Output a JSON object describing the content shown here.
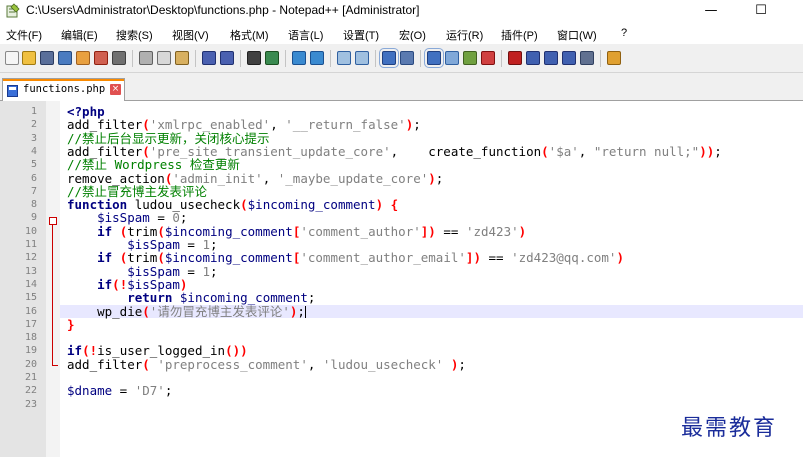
{
  "window": {
    "title": "C:\\Users\\Administrator\\Desktop\\functions.php - Notepad++ [Administrator]",
    "minimize": "—",
    "maximize": "☐"
  },
  "menu": [
    "文件(F)",
    "编辑(E)",
    "搜索(S)",
    "视图(V)",
    "格式(M)",
    "语言(L)",
    "设置(T)",
    "宏(O)",
    "运行(R)",
    "插件(P)",
    "窗口(W)",
    "?"
  ],
  "tab": {
    "label": "functions.php",
    "close": "×"
  },
  "editor": {
    "current_line": 16,
    "line_numbers": [
      "1",
      "2",
      "3",
      "4",
      "5",
      "6",
      "7",
      "8",
      "9",
      "10",
      "11",
      "12",
      "13",
      "14",
      "15",
      "16",
      "17",
      "18",
      "19",
      "20",
      "21",
      "22",
      "23"
    ],
    "lines": [
      [
        [
          "kw",
          "<?php"
        ]
      ],
      [
        [
          "",
          "add_filter"
        ],
        [
          "op",
          "("
        ],
        [
          "str",
          "'xmlrpc_enabled'"
        ],
        [
          "",
          ", "
        ],
        [
          "str",
          "'__return_false'"
        ],
        [
          "op",
          ")"
        ],
        [
          "",
          ";"
        ]
      ],
      [
        [
          "cmt",
          "//禁止后台显示更新，关闭核心提示"
        ]
      ],
      [
        [
          "",
          "add_filter"
        ],
        [
          "op",
          "("
        ],
        [
          "str",
          "'pre_site_transient_update_core'"
        ],
        [
          "",
          ",    create_function"
        ],
        [
          "op",
          "("
        ],
        [
          "str",
          "'$a'"
        ],
        [
          "",
          ", "
        ],
        [
          "str",
          "\"return null;\""
        ],
        [
          "op",
          "))"
        ],
        [
          "",
          ";"
        ]
      ],
      [
        [
          "cmt",
          "//禁止 Wordpress 检查更新"
        ]
      ],
      [
        [
          "",
          "remove_action"
        ],
        [
          "op",
          "("
        ],
        [
          "str",
          "'admin_init'"
        ],
        [
          "",
          ", "
        ],
        [
          "str",
          "'_maybe_update_core'"
        ],
        [
          "op",
          ")"
        ],
        [
          "",
          ";"
        ]
      ],
      [
        [
          "cmt",
          "//禁止冒充博主发表评论"
        ]
      ],
      [
        [
          "kw",
          "function"
        ],
        [
          "",
          " ludou_usecheck"
        ],
        [
          "op",
          "("
        ],
        [
          "var",
          "$incoming_comment"
        ],
        [
          "op",
          ")"
        ],
        [
          "",
          " "
        ],
        [
          "op",
          "{"
        ]
      ],
      [
        [
          "",
          "    "
        ],
        [
          "var",
          "$isSpam"
        ],
        [
          "",
          " = "
        ],
        [
          "str",
          "0"
        ],
        [
          "",
          ";"
        ]
      ],
      [
        [
          "",
          "    "
        ],
        [
          "kw",
          "if"
        ],
        [
          "",
          " "
        ],
        [
          "op",
          "("
        ],
        [
          "",
          "trim"
        ],
        [
          "op",
          "("
        ],
        [
          "var",
          "$incoming_comment"
        ],
        [
          "op",
          "["
        ],
        [
          "str",
          "'comment_author'"
        ],
        [
          "op",
          "])"
        ],
        [
          "",
          " == "
        ],
        [
          "str",
          "'zd423'"
        ],
        [
          "op",
          ")"
        ]
      ],
      [
        [
          "",
          "        "
        ],
        [
          "var",
          "$isSpam"
        ],
        [
          "",
          " = "
        ],
        [
          "str",
          "1"
        ],
        [
          "",
          ";"
        ]
      ],
      [
        [
          "",
          "    "
        ],
        [
          "kw",
          "if"
        ],
        [
          "",
          " "
        ],
        [
          "op",
          "("
        ],
        [
          "",
          "trim"
        ],
        [
          "op",
          "("
        ],
        [
          "var",
          "$incoming_comment"
        ],
        [
          "op",
          "["
        ],
        [
          "str",
          "'comment_author_email'"
        ],
        [
          "op",
          "])"
        ],
        [
          "",
          " == "
        ],
        [
          "str",
          "'zd423@qq.com'"
        ],
        [
          "op",
          ")"
        ]
      ],
      [
        [
          "",
          "        "
        ],
        [
          "var",
          "$isSpam"
        ],
        [
          "",
          " = "
        ],
        [
          "str",
          "1"
        ],
        [
          "",
          ";"
        ]
      ],
      [
        [
          "",
          "    "
        ],
        [
          "kw",
          "if"
        ],
        [
          "op",
          "(!"
        ],
        [
          "var",
          "$isSpam"
        ],
        [
          "op",
          ")"
        ]
      ],
      [
        [
          "",
          "        "
        ],
        [
          "kw",
          "return"
        ],
        [
          "",
          " "
        ],
        [
          "var",
          "$incoming_comment"
        ],
        [
          "",
          ";"
        ]
      ],
      [
        [
          "",
          "    wp_die"
        ],
        [
          "op",
          "("
        ],
        [
          "str",
          "'请勿冒充博主发表评论'"
        ],
        [
          "op",
          ")"
        ],
        [
          "",
          ";"
        ],
        [
          "caret",
          ""
        ]
      ],
      [
        [
          "op",
          "}"
        ]
      ],
      [],
      [
        [
          "kw",
          "if"
        ],
        [
          "op",
          "(!"
        ],
        [
          "",
          "is_user_logged_in"
        ],
        [
          "op",
          "())"
        ]
      ],
      [
        [
          "",
          "add_filter"
        ],
        [
          "op",
          "("
        ],
        [
          "",
          " "
        ],
        [
          "str",
          "'preprocess_comment'"
        ],
        [
          "",
          ", "
        ],
        [
          "str",
          "'ludou_usecheck'"
        ],
        [
          "",
          " "
        ],
        [
          "op",
          ")"
        ],
        [
          "",
          ";"
        ]
      ],
      [],
      [
        [
          "var",
          "$dname"
        ],
        [
          "",
          " = "
        ],
        [
          "str",
          "'D7'"
        ],
        [
          "",
          ";"
        ]
      ],
      []
    ]
  },
  "watermark": "最需教育",
  "colors": {
    "keyword": "#000080",
    "string": "#808080",
    "comment": "#008000",
    "operator": "#ff0000",
    "current_line_bg": "#e8e8ff",
    "tab_accent": "#fa8a00"
  }
}
